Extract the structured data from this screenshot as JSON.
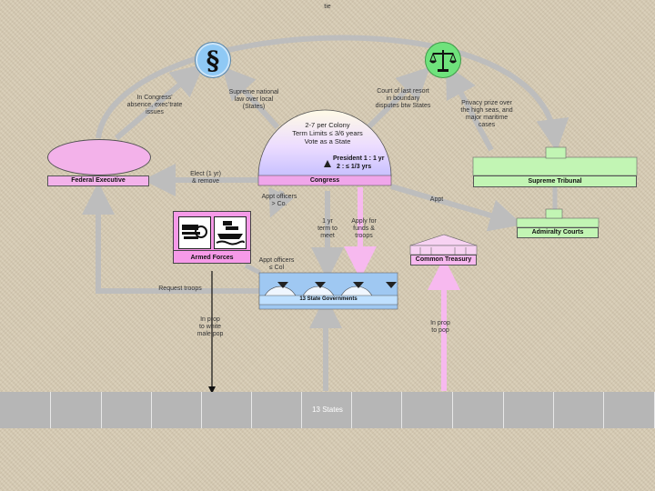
{
  "colors": {
    "arrow": "#bdbdbd",
    "executive": "#f3b2ea",
    "tribunal": "#c2f5b4",
    "congress_top": "#fffbe6",
    "congress_bottom": "#c7c0ff",
    "armed_forces": "#f69ae8",
    "treasury": "#f7b9ef",
    "states_bar": "#b6b6b6",
    "pink_arrow": "#f7b9ef",
    "icon_blue": "#8fc9f5",
    "icon_green": "#6fe27c"
  },
  "icons": {
    "law": "section-sign-icon",
    "justice": "scales-icon"
  },
  "labels": {
    "top": "tie",
    "congress_law": "In Congress'\nabsence, exec’trate\nissues",
    "supreme_law": "Supreme national\nlaw over local\n(States)",
    "court_last_resort": "Court of last resort\nin boundary\ndisputes btw States",
    "privacy": "Privacy prize over\nthe high seas, and\nmajor maritime\ncases",
    "elect": "Elect (1 yr)\n& remove",
    "appt_officers_co": "Appt officers\n> Co.",
    "appt": "Appt",
    "term_1yr": "1 yr\nterm to\nmeet",
    "apply_funds": "Apply for\nfunds &\ntroops",
    "appt_officers_col": "Appt officers\n≤ Col",
    "request_troops": "Request troops",
    "in_prop_white": "In prop\nto white\nmale pop",
    "in_prop_pop": "In prop\nto pop"
  },
  "congress": {
    "text": "2-7 per Colony\nTerm Limits ≤ 3/6 years\nVote as a State",
    "president_line1": "President 1 : 1 yr",
    "president_line2": "2 : ≤ 1/3 yrs",
    "label": "Congress"
  },
  "boxes": {
    "federal_executive": "Federal Executive",
    "supreme_tribunal": "Supreme Tribunal",
    "admiralty_courts": "Admiralty Courts",
    "armed_forces": "Armed Forces",
    "common_treasury": "Common Treasury",
    "state_governments": "13 State Governments",
    "states": "13 States"
  }
}
